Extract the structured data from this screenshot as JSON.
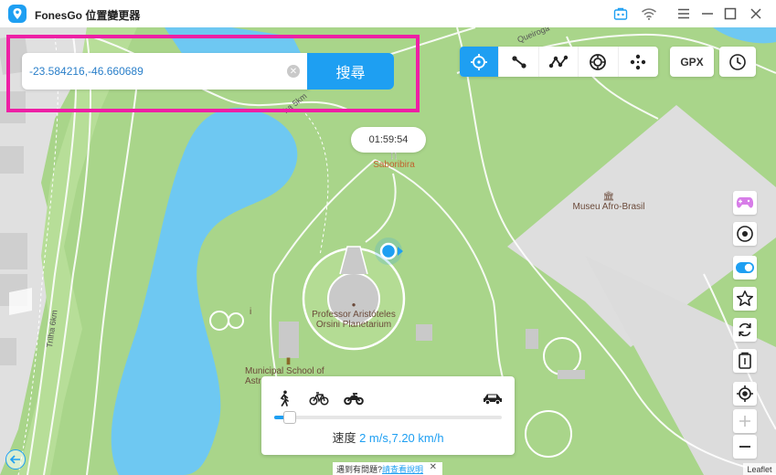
{
  "app": {
    "title": "FonesGo 位置變更器"
  },
  "search": {
    "value": "-23.584216,-46.660689",
    "button_label": "搜尋"
  },
  "toolbar": {
    "gpx_label": "GPX"
  },
  "timer": "01:59:54",
  "map": {
    "labels": {
      "saboribira": "Saboribira",
      "museu": "Museu Afro-Brasil",
      "planetarium_line1": "Professor Aristóteles",
      "planetarium_line2": "Orsini Planetarium",
      "school_line1": "Municipal School of",
      "school_line2": "Astro"
    },
    "roads": {
      "queiroga": "Queiroga",
      "trilha": "Trilha 6km",
      "barra": "ha 5km"
    }
  },
  "speed": {
    "label": "速度",
    "value": "2 m/s,7.20 km/h",
    "level": 0.07
  },
  "help": {
    "prefix": "遇到有問題?",
    "link": "請查看說明",
    "close": "✕"
  },
  "attribution": "Leaflet",
  "colors": {
    "accent": "#1e9ff2",
    "highlight": "#ee1fa5",
    "park": "#a9d58a",
    "water": "#6ec8f2"
  }
}
